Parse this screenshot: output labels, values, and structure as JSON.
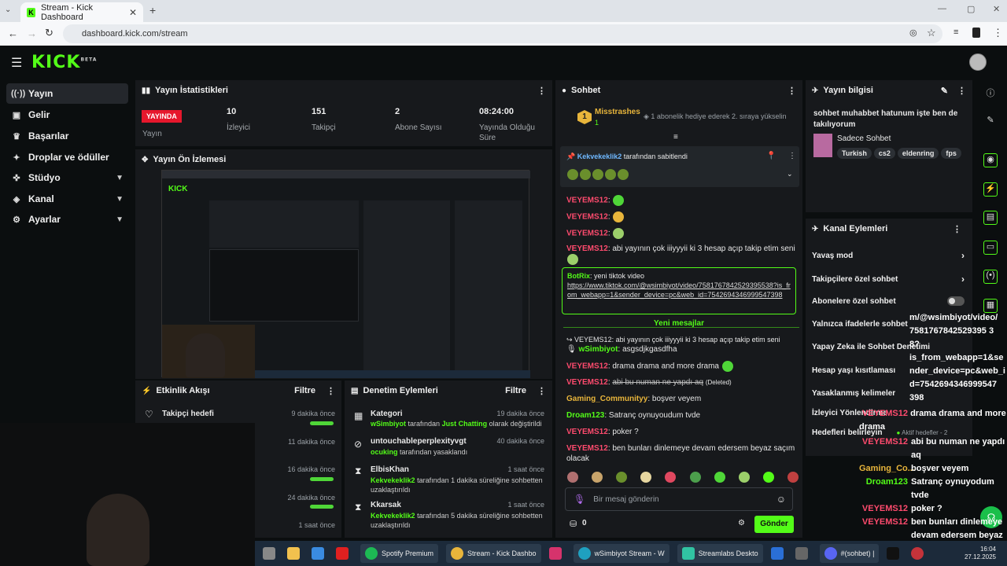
{
  "browser": {
    "tab_title": "Stream - Kick Dashboard",
    "url": "dashboard.kick.com/stream"
  },
  "header": {
    "logo": "KICK",
    "logo_sup": "BETA"
  },
  "sidebar": {
    "items": [
      {
        "label": "Yayın",
        "icon": "broadcast-icon"
      },
      {
        "label": "Gelir",
        "icon": "revenue-icon"
      },
      {
        "label": "Başarılar",
        "icon": "trophy-icon"
      },
      {
        "label": "Droplar ve ödüller",
        "icon": "drops-icon"
      },
      {
        "label": "Stüdyo",
        "icon": "studio-icon"
      },
      {
        "label": "Kanal",
        "icon": "channel-icon"
      },
      {
        "label": "Ayarlar",
        "icon": "settings-icon"
      }
    ]
  },
  "stats": {
    "title": "Yayın İstatistikleri",
    "live": "YAYINDA",
    "live_label": "Yayın",
    "viewers_value": "10",
    "viewers_label": "İzleyici",
    "followers_value": "151",
    "followers_label": "Takipçi",
    "subs_value": "2",
    "subs_label": "Abone Sayısı",
    "duration_value": "08:24:00",
    "duration_label": "Yayında Olduğu Süre"
  },
  "preview": {
    "title": "Yayın Ön İzlemesi"
  },
  "activity": {
    "title": "Etkinlik Akışı",
    "filter": "Filtre",
    "items": [
      {
        "label": "Takipçi hedefi",
        "time": "9 dakika önce"
      },
      {
        "label": "",
        "time": "11 dakika önce"
      },
      {
        "label": "",
        "time": "16 dakika önce"
      },
      {
        "label": "",
        "time": "24 dakika önce"
      },
      {
        "label": "",
        "time": "1 saat önce"
      }
    ]
  },
  "moderation": {
    "title": "Denetim Eylemleri",
    "filter": "Filtre",
    "items": [
      {
        "title": "Kategori",
        "time": "19 dakika önce",
        "user": "wSimbiyot",
        "text1": " tarafından ",
        "hl": "Just Chatting",
        "text2": " olarak değiştirildi"
      },
      {
        "title": "untouchableperplexityvgt",
        "time": "40 dakika önce",
        "user": "ocuking",
        "text1": " tarafından yasaklandı",
        "hl": "",
        "text2": ""
      },
      {
        "title": "ElbisKhan",
        "time": "1 saat önce",
        "user": "Kekvekeklik2",
        "text1": " tarafından 1 dakika süreliğine sohbetten uzaklaştırıldı",
        "hl": "",
        "text2": ""
      },
      {
        "title": "Kkarsak",
        "time": "1 saat önce",
        "user": "Kekvekeklik2",
        "text1": " tarafından 5 dakika süreliğine sohbetten uzaklaştırıldı",
        "hl": "",
        "text2": ""
      }
    ]
  },
  "chat": {
    "title": "Sohbet",
    "gift_user": "Misstrashes",
    "gift_count": "1",
    "gift_text": "1 abonelik hediye ederek 2. sıraya yükselin",
    "pinned_by": "Kekvekeklik2",
    "pinned_text": " tarafından sabitlendi",
    "messages": [
      {
        "user": "VEYEMS12",
        "text": ""
      },
      {
        "user": "VEYEMS12",
        "text": ""
      },
      {
        "user": "VEYEMS12",
        "text": ""
      },
      {
        "user": "VEYEMS12",
        "text": "abi yayının çok iiiyyyii ki 3 hesap açıp takip etim seni"
      }
    ],
    "bot_user": "BotRix",
    "bot_text": "yeni tiktok video",
    "bot_link": "https://www.tiktok.com/@wsimbiyot/video/7581767842529395538?is_from_webapp=1&sender_device=pc&web_id=7542694346999547398",
    "new_messages": "Yeni mesajlar",
    "reply_text": "VEYEMS12: abi yayının çok iiiyyyii ki 3 hesap açıp takip etim seni",
    "reply_user": "wSimbiyot",
    "reply_msg": "asgsdjkgasdfha",
    "messages2": [
      {
        "user": "VEYEMS12",
        "text": "drama drama and more drama"
      },
      {
        "user": "VEYEMS12",
        "text": "abi bu numan ne yapdı aq",
        "deleted": "(Deleted)"
      },
      {
        "user": "Gaming_Communityy",
        "text": "boşver veyem"
      },
      {
        "user": "Droam123",
        "text": "Satranç oynuyoudum tvde"
      },
      {
        "user": "VEYEMS12",
        "text": "poker ?"
      },
      {
        "user": "VEYEMS12",
        "text": "ben bunları dinlemeye devam edersem beyaz saçım olacak"
      }
    ],
    "input_placeholder": "Bir mesaj gönderin",
    "points": "0",
    "send": "Gönder"
  },
  "info": {
    "title": "Yayın bilgisi",
    "stream_title": "sohbet muhabbet hatunum işte ben de takılıyorum",
    "category": "Sadece Sohbet",
    "tags": [
      "Turkish",
      "cs2",
      "eldenring",
      "fps"
    ]
  },
  "channel_actions": {
    "title": "Kanal Eylemleri",
    "items": [
      {
        "label": "Yavaş mod"
      },
      {
        "label": "Takipçilere özel sohbet"
      },
      {
        "label": "Abonelere özel sohbet"
      },
      {
        "label": "Yalnızca ifadelerle sohbet"
      },
      {
        "label": "Yapay Zeka ile Sohbet Denetimi"
      },
      {
        "label": "Hesap yaşı kısıtlaması"
      },
      {
        "label": "Yasaklanmış kelimeler"
      },
      {
        "label": "İzleyici Yönlendirme"
      },
      {
        "label": "Hedefleri belirleyin"
      }
    ],
    "active_goals": "Aktif hedefler - 2"
  },
  "overlay": {
    "line1": "m/@wsimbiyot/video/",
    "line2": "7581767842529395 3",
    "line3": "8?",
    "line4": "is_from_webapp=1&se",
    "line5": "nder_device=pc&web_i",
    "line6": "d=7542694346999547",
    "line7": "398",
    "msgs": [
      {
        "user": "VEYEMS12",
        "text": "drama drama and more drama"
      },
      {
        "user": "VEYEMS12",
        "text": "abi bu numan ne yapdı aq"
      },
      {
        "user": "Gaming_Co...",
        "text": "boşver veyem"
      },
      {
        "user": "Droam123",
        "text": "Satranç oynuyodum tvde"
      },
      {
        "user": "VEYEMS12",
        "text": "poker ?"
      },
      {
        "user": "VEYEMS12",
        "text": "ben bunları dinlemeye devam edersem beyaz saçım olacak"
      }
    ]
  },
  "taskbar": {
    "items": [
      "Spotify Premium",
      "Stream - Kick Dashbo",
      "wSimbiyot Stream - W",
      "Streamlabs Deskto",
      "#(sohbet) |"
    ],
    "time": "16:04",
    "date": "27.12.2025"
  },
  "colors": {
    "accent": "#53fc18",
    "live": "#e6172c",
    "username": "#ff4b6e",
    "panel": "#17191c"
  }
}
